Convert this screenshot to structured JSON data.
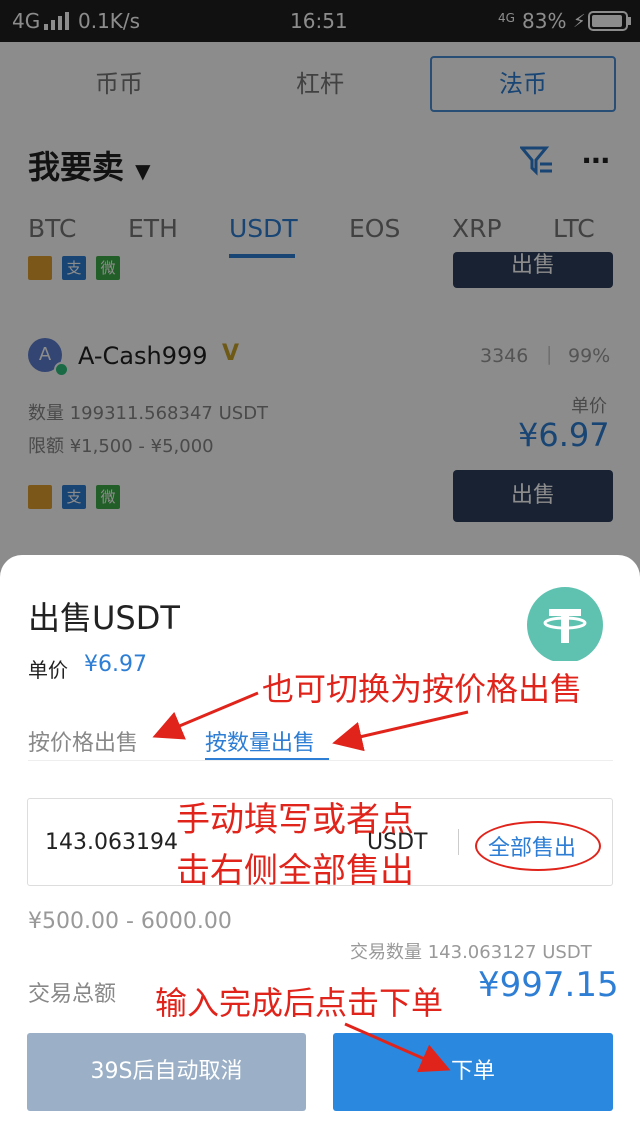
{
  "status_bar": {
    "network": "4G",
    "speed": "0.1K/s",
    "time": "16:51",
    "network_right": "4G",
    "battery": "83%"
  },
  "top_tabs": [
    "币币",
    "杠杆",
    "法币"
  ],
  "page_title": "我要卖",
  "coins": [
    "BTC",
    "ETH",
    "USDT",
    "EOS",
    "XRP",
    "LTC"
  ],
  "listing_top": {
    "tags": [
      "支",
      "微"
    ],
    "sell_label": "出售"
  },
  "listing": {
    "avatar_letter": "A",
    "name": "A-Cash999",
    "orders": "3346",
    "rate": "99%",
    "amount": "数量 199311.568347 USDT",
    "limit": "限额 ¥1,500 - ¥5,000",
    "price_label": "单价",
    "price": "¥6.97",
    "tags": [
      "支",
      "微"
    ],
    "sell_label": "出售"
  },
  "sheet": {
    "title": "出售USDT",
    "unit_price_label": "单价",
    "unit_price": "¥6.97",
    "tab_price": "按价格出售",
    "tab_qty": "按数量出售",
    "input_value": "143.063194",
    "input_unit": "USDT",
    "sell_all": "全部售出",
    "range": "¥500.00 - 6000.00",
    "trade_qty": "交易数量 143.063127 USDT",
    "total_label": "交易总额",
    "total": "¥997.15",
    "cancel_btn": "39S后自动取消",
    "submit_btn": "下单"
  },
  "annotations": {
    "switch_note": "也可切换为按价格出售",
    "fill_note_1": "手动填写或者点",
    "fill_note_2": "击右侧全部售出",
    "submit_note": "输入完成后点击下单"
  },
  "colors": {
    "accent": "#2d7ed4",
    "annotation": "#e0241b",
    "tether": "#5fc2b0",
    "sell_button": "#2c3e5c"
  }
}
